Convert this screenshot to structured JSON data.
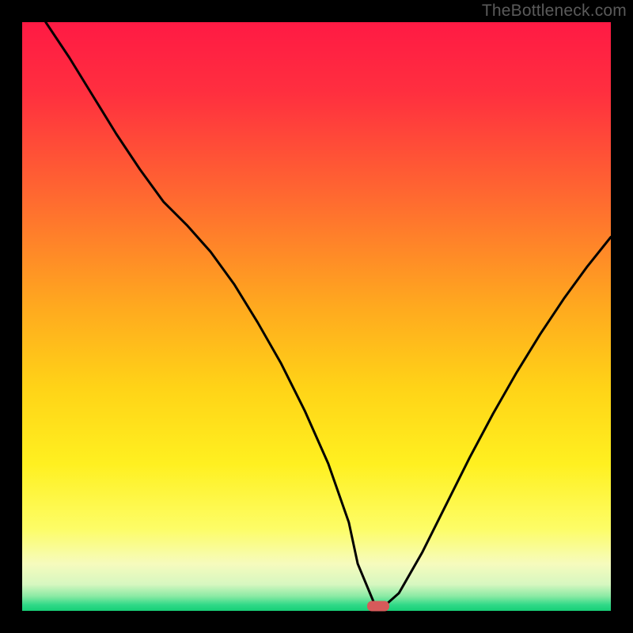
{
  "watermark": {
    "text": "TheBottleneck.com"
  },
  "colors": {
    "gradient_stops": [
      {
        "offset": 0.0,
        "color": "#ff1a44"
      },
      {
        "offset": 0.12,
        "color": "#ff2f3f"
      },
      {
        "offset": 0.3,
        "color": "#ff6a30"
      },
      {
        "offset": 0.48,
        "color": "#ffa81f"
      },
      {
        "offset": 0.62,
        "color": "#ffd317"
      },
      {
        "offset": 0.75,
        "color": "#fff020"
      },
      {
        "offset": 0.86,
        "color": "#fdfd66"
      },
      {
        "offset": 0.92,
        "color": "#f6fbbd"
      },
      {
        "offset": 0.955,
        "color": "#d7f7c0"
      },
      {
        "offset": 0.975,
        "color": "#8beaa4"
      },
      {
        "offset": 0.99,
        "color": "#2fd987"
      },
      {
        "offset": 1.0,
        "color": "#17cf77"
      }
    ],
    "curve_stroke": "#000000",
    "marker_fill": "#d65a5a",
    "frame": "#000000"
  },
  "chart_data": {
    "type": "line",
    "title": "",
    "xlabel": "",
    "ylabel": "",
    "xlim": [
      0,
      100
    ],
    "ylim": [
      0,
      100
    ],
    "grid": false,
    "series": [
      {
        "name": "bottleneck-curve",
        "x": [
          4,
          8,
          12,
          16,
          20,
          24,
          28,
          32,
          36,
          40,
          44,
          48,
          52,
          55.5,
          57,
          60,
          61.5,
          64,
          68,
          72,
          76,
          80,
          84,
          88,
          92,
          96,
          100
        ],
        "y": [
          100,
          94,
          87.5,
          81,
          75,
          69.5,
          65.5,
          61,
          55.5,
          49,
          42,
          34,
          25,
          15,
          8,
          0.8,
          0.8,
          3,
          10,
          18,
          26,
          33.5,
          40.5,
          47,
          53,
          58.5,
          63.5
        ]
      }
    ],
    "marker": {
      "x": 60.5,
      "y": 0.8
    },
    "legend": false
  }
}
